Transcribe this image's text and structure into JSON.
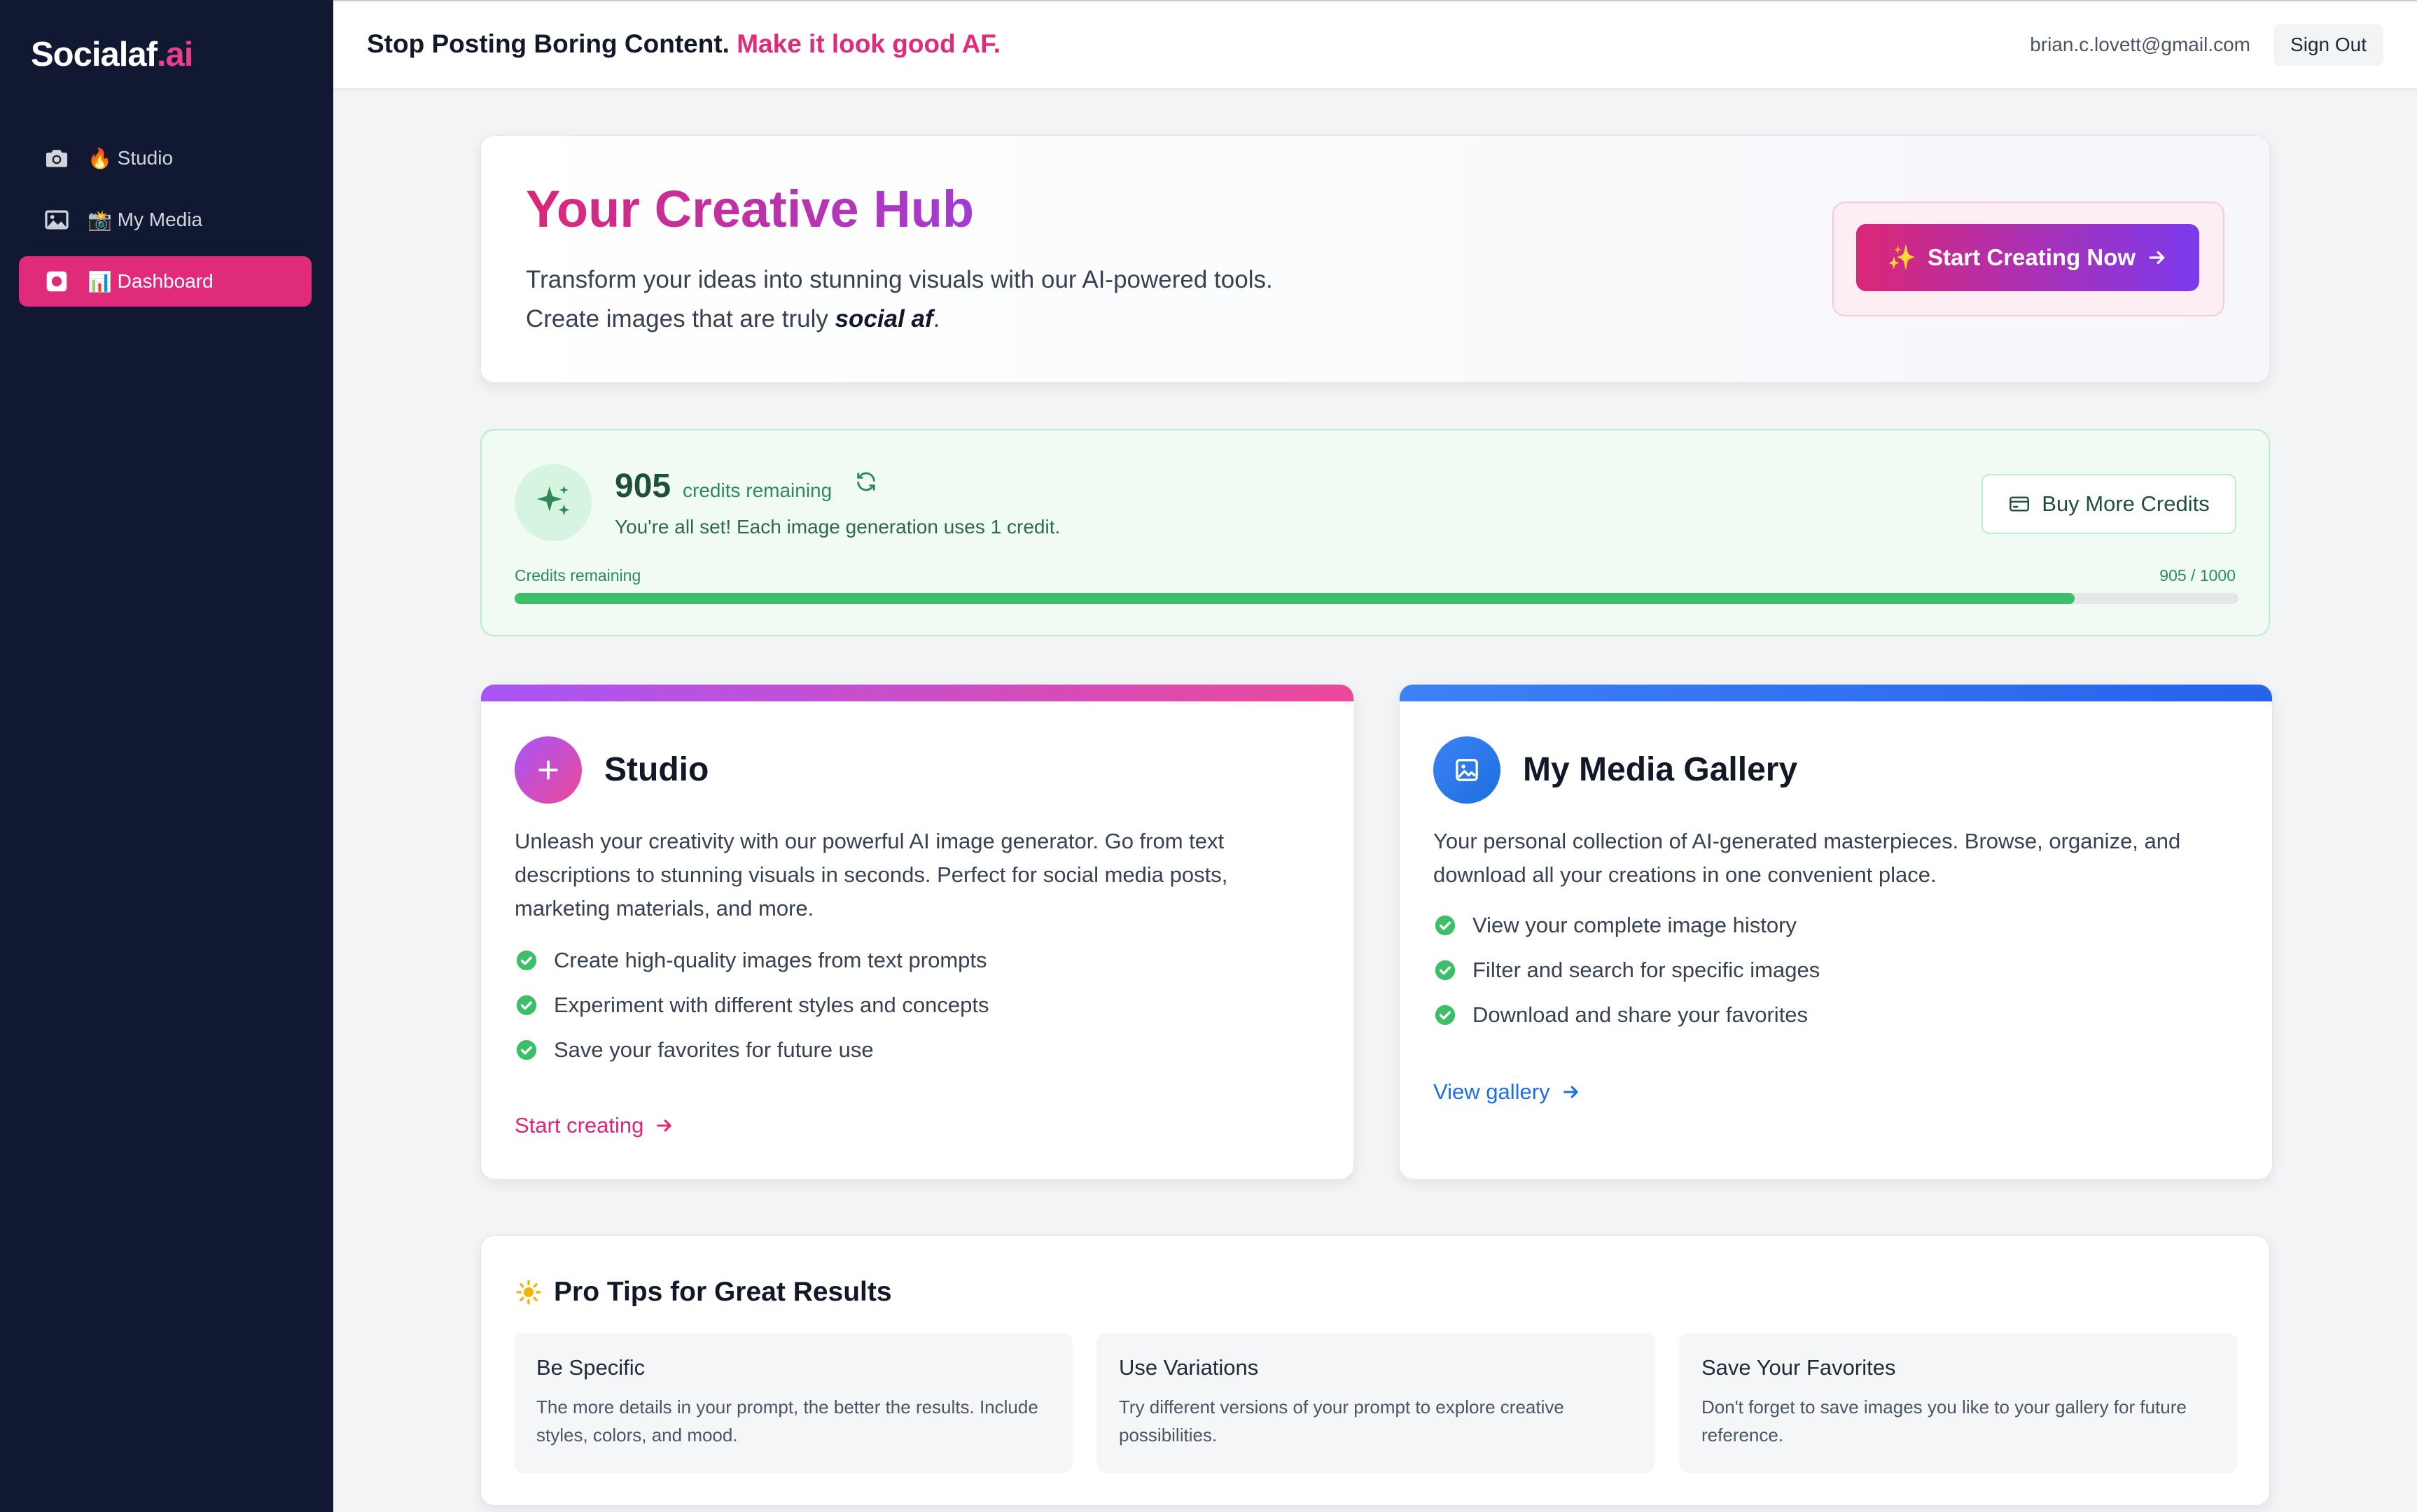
{
  "sidebar": {
    "logo_main": "Socialaf",
    "logo_accent": ".ai",
    "items": [
      {
        "emoji": "🔥",
        "label": "Studio",
        "icon": "camera-icon"
      },
      {
        "emoji": "📸",
        "label": "My Media",
        "icon": "image-icon"
      },
      {
        "emoji": "📊",
        "label": "Dashboard",
        "icon": "dashboard-icon",
        "active": true
      }
    ]
  },
  "header": {
    "tagline_main": "Stop Posting Boring Content. ",
    "tagline_accent": "Make it look good AF.",
    "user_email": "brian.c.lovett@gmail.com",
    "signout_label": "Sign Out"
  },
  "hero": {
    "title": "Your Creative Hub",
    "line1": "Transform your ideas into stunning visuals with our AI-powered tools.",
    "line2_prefix": "Create images that are truly ",
    "line2_emph": "social af",
    "line2_suffix": ".",
    "cta_emoji": "✨",
    "cta_label": "Start Creating Now"
  },
  "credits": {
    "remaining": "905",
    "label": "credits remaining",
    "subtitle": "You're all set! Each image generation uses 1 credit.",
    "buy_label": "Buy More Credits",
    "bar_label": "Credits remaining",
    "bar_count": "905 / 1000",
    "fraction": 0.905
  },
  "studio_card": {
    "title": "Studio",
    "description": "Unleash your creativity with our powerful AI image generator. Go from text descriptions to stunning visuals in seconds. Perfect for social media posts, marketing materials, and more.",
    "features": [
      "Create high-quality images from text prompts",
      "Experiment with different styles and concepts",
      "Save your favorites for future use"
    ],
    "link_label": "Start creating"
  },
  "media_card": {
    "title": "My Media Gallery",
    "description": "Your personal collection of AI-generated masterpieces. Browse, organize, and download all your creations in one convenient place.",
    "features": [
      "View your complete image history",
      "Filter and search for specific images",
      "Download and share your favorites"
    ],
    "link_label": "View gallery"
  },
  "tips": {
    "title": "Pro Tips for Great Results",
    "items": [
      {
        "title": "Be Specific",
        "text": "The more details in your prompt, the better the results. Include styles, colors, and mood."
      },
      {
        "title": "Use Variations",
        "text": "Try different versions of your prompt to explore creative possibilities."
      },
      {
        "title": "Save Your Favorites",
        "text": "Don't forget to save images you like to your gallery for future reference."
      }
    ]
  },
  "colors": {
    "sidebar_bg": "#111832",
    "accent_pink": "#e02a7a",
    "accent_purple": "#7c3aed",
    "success_green": "#3cbf68",
    "link_blue": "#1d6fe0"
  }
}
